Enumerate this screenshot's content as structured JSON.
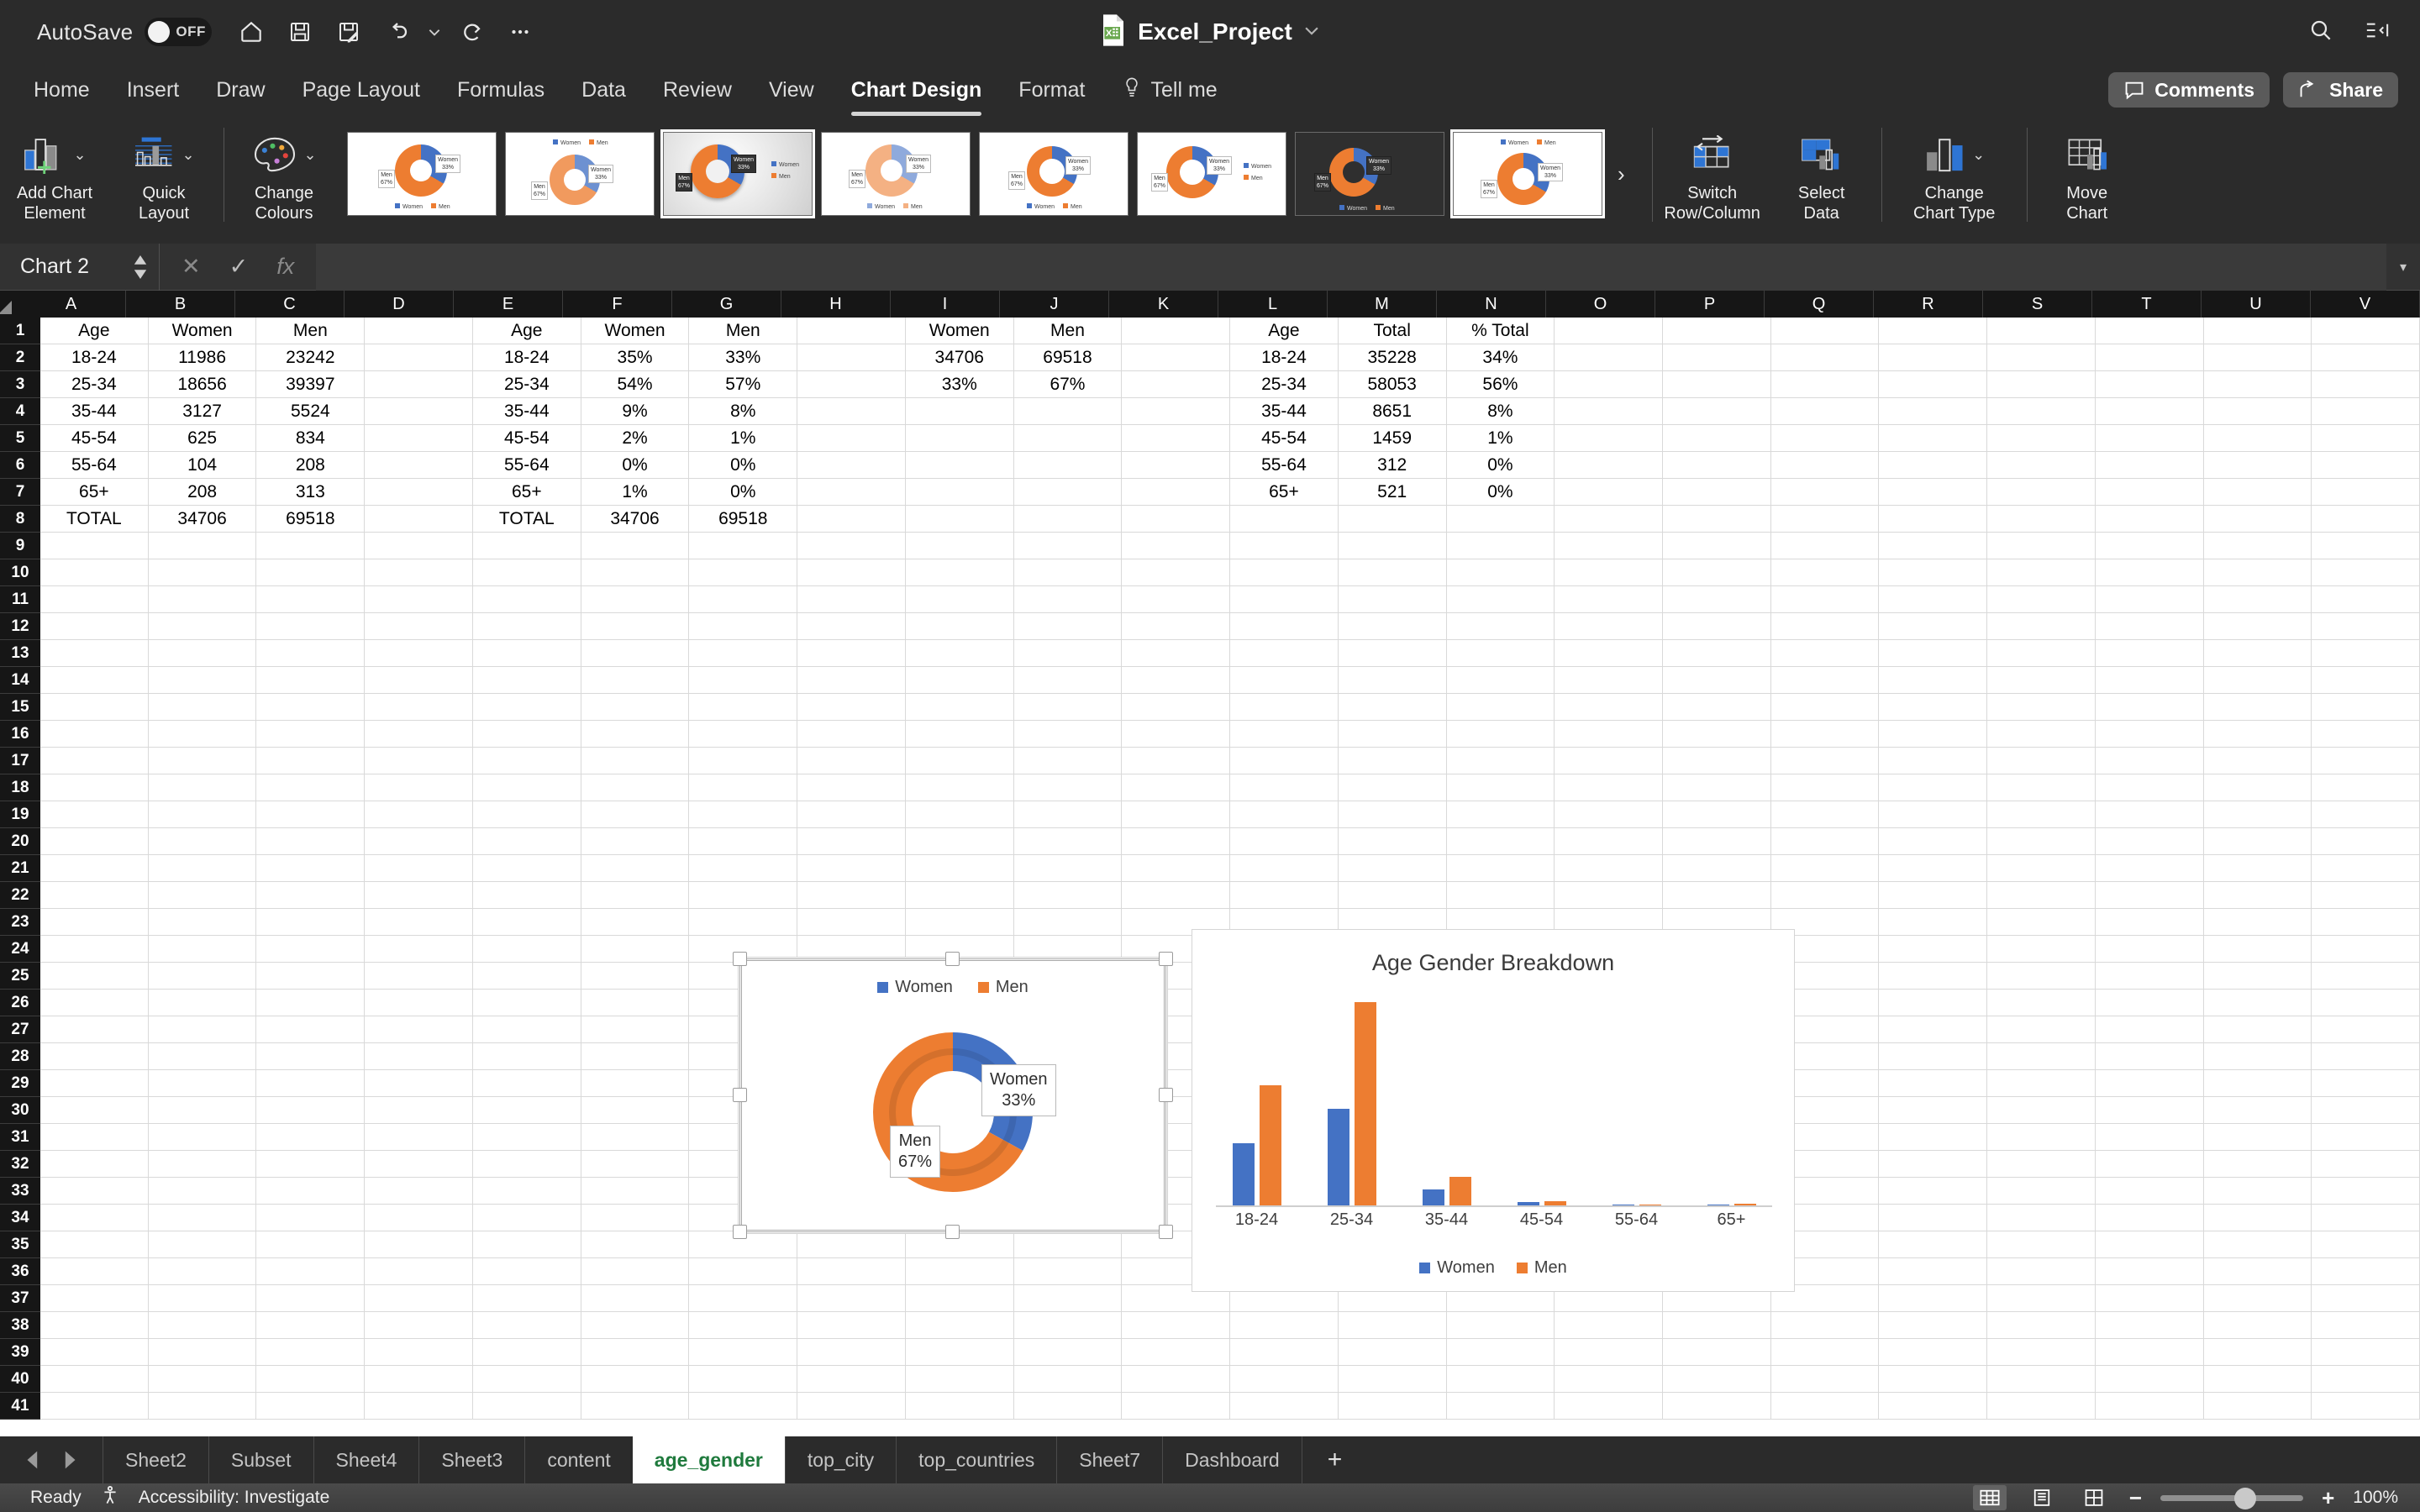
{
  "titlebar": {
    "autosave_label": "AutoSave",
    "autosave_state": "OFF",
    "doc_title": "Excel_Project",
    "icons": [
      "home-icon",
      "save-icon",
      "save-as-icon",
      "undo-icon",
      "undo-dropdown-icon",
      "redo-icon",
      "more-commands-icon",
      "search-icon",
      "ribbon-display-icon"
    ]
  },
  "tabs": {
    "items": [
      {
        "label": "Home",
        "active": false
      },
      {
        "label": "Insert",
        "active": false
      },
      {
        "label": "Draw",
        "active": false
      },
      {
        "label": "Page Layout",
        "active": false
      },
      {
        "label": "Formulas",
        "active": false
      },
      {
        "label": "Data",
        "active": false
      },
      {
        "label": "Review",
        "active": false
      },
      {
        "label": "View",
        "active": false
      },
      {
        "label": "Chart Design",
        "active": true
      },
      {
        "label": "Format",
        "active": false
      },
      {
        "label": "Tell me",
        "active": false
      }
    ],
    "comments_label": "Comments",
    "share_label": "Share"
  },
  "ribbon": {
    "add_chart_element": "Add Chart\nElement",
    "add_chart_element_l1": "Add Chart",
    "add_chart_element_l2": "Element",
    "quick_layout_l1": "Quick",
    "quick_layout_l2": "Layout",
    "change_colours_l1": "Change",
    "change_colours_l2": "Colours",
    "switch_row_column_l1": "Switch",
    "switch_row_column_l2": "Row/Column",
    "select_data_l1": "Select",
    "select_data_l2": "Data",
    "change_chart_type_l1": "Change",
    "change_chart_type_l2": "Chart Type",
    "move_chart_l1": "Move",
    "move_chart_l2": "Chart",
    "gallery_more": "›",
    "gallery_styles": [
      {
        "id": "style-1",
        "selected": false,
        "bg": "white",
        "legend": "bottom"
      },
      {
        "id": "style-2",
        "selected": false,
        "bg": "white",
        "legend": "top"
      },
      {
        "id": "style-3",
        "selected": true,
        "bg": "gradient",
        "legend": "right"
      },
      {
        "id": "style-4",
        "selected": false,
        "bg": "white",
        "legend": "bottom"
      },
      {
        "id": "style-5",
        "selected": false,
        "bg": "white",
        "legend": "bottom"
      },
      {
        "id": "style-6",
        "selected": false,
        "bg": "white",
        "legend": "right"
      },
      {
        "id": "style-7",
        "selected": false,
        "bg": "dark",
        "legend": "bottom"
      },
      {
        "id": "style-8",
        "selected": false,
        "bg": "white",
        "legend": "top"
      }
    ]
  },
  "formulabar": {
    "namebox_value": "Chart 2",
    "cancel_icon": "✕",
    "enter_icon": "✓",
    "fx_icon": "fx",
    "formula_value": ""
  },
  "grid": {
    "columns": [
      "A",
      "B",
      "C",
      "D",
      "E",
      "F",
      "G",
      "H",
      "I",
      "J",
      "K",
      "L",
      "M",
      "N",
      "O",
      "P",
      "Q",
      "R",
      "S",
      "T",
      "U",
      "V"
    ],
    "rows": [
      1,
      2,
      3,
      4,
      5,
      6,
      7,
      8,
      9,
      10,
      11,
      12,
      13,
      14,
      15,
      16,
      17,
      18,
      19,
      20,
      21,
      22,
      23,
      24,
      25,
      26,
      27,
      28,
      29,
      30,
      31,
      32,
      33,
      34,
      35,
      36,
      37,
      38,
      39,
      40,
      41
    ],
    "data": [
      [
        "Age",
        "Women",
        "Men",
        "",
        "Age",
        "Women",
        "Men",
        "",
        "Women",
        "Men",
        "",
        "Age",
        "Total",
        "% Total",
        "",
        "",
        "",
        "",
        "",
        "",
        "",
        ""
      ],
      [
        "18-24",
        "11986",
        "23242",
        "",
        "18-24",
        "35%",
        "33%",
        "",
        "34706",
        "69518",
        "",
        "18-24",
        "35228",
        "34%",
        "",
        "",
        "",
        "",
        "",
        "",
        "",
        ""
      ],
      [
        "25-34",
        "18656",
        "39397",
        "",
        "25-34",
        "54%",
        "57%",
        "",
        "33%",
        "67%",
        "",
        "25-34",
        "58053",
        "56%",
        "",
        "",
        "",
        "",
        "",
        "",
        "",
        ""
      ],
      [
        "35-44",
        "3127",
        "5524",
        "",
        "35-44",
        "9%",
        "8%",
        "",
        "",
        "",
        "",
        "35-44",
        "8651",
        "8%",
        "",
        "",
        "",
        "",
        "",
        "",
        "",
        ""
      ],
      [
        "45-54",
        "625",
        "834",
        "",
        "45-54",
        "2%",
        "1%",
        "",
        "",
        "",
        "",
        "45-54",
        "1459",
        "1%",
        "",
        "",
        "",
        "",
        "",
        "",
        "",
        ""
      ],
      [
        "55-64",
        "104",
        "208",
        "",
        "55-64",
        "0%",
        "0%",
        "",
        "",
        "",
        "",
        "55-64",
        "312",
        "0%",
        "",
        "",
        "",
        "",
        "",
        "",
        "",
        ""
      ],
      [
        "65+",
        "208",
        "313",
        "",
        "65+",
        "1%",
        "0%",
        "",
        "",
        "",
        "",
        "65+",
        "521",
        "0%",
        "",
        "",
        "",
        "",
        "",
        "",
        "",
        ""
      ],
      [
        "TOTAL",
        "34706",
        "69518",
        "",
        "TOTAL",
        "34706",
        "69518",
        "",
        "",
        "",
        "",
        "",
        "",
        "",
        "",
        "",
        "",
        "",
        "",
        "",
        "",
        ""
      ]
    ]
  },
  "donut_chart": {
    "name": "Chart 2",
    "selected": true,
    "legend": [
      {
        "label": "Women",
        "color": "#4472c4"
      },
      {
        "label": "Men",
        "color": "#ed7d31"
      }
    ],
    "callouts": [
      {
        "name": "Women",
        "value": "33%"
      },
      {
        "name": "Men",
        "value": "67%"
      }
    ]
  },
  "bar_chart": {
    "title": "Age Gender Breakdown",
    "legend": [
      {
        "label": "Women",
        "color": "#4472c4"
      },
      {
        "label": "Men",
        "color": "#ed7d31"
      }
    ]
  },
  "chart_data": [
    {
      "type": "pie",
      "title": "",
      "subtype": "doughnut",
      "labels": [
        "Women",
        "Men"
      ],
      "values": [
        34706,
        69518
      ],
      "percentages": [
        33,
        67
      ],
      "colors": [
        "#4472c4",
        "#ed7d31"
      ],
      "legend_position": "top",
      "data_labels": [
        "Women 33%",
        "Men 67%"
      ]
    },
    {
      "type": "bar",
      "title": "Age Gender Breakdown",
      "categories": [
        "18-24",
        "25-34",
        "35-44",
        "45-54",
        "55-64",
        "65+"
      ],
      "series": [
        {
          "name": "Women",
          "color": "#4472c4",
          "values": [
            11986,
            18656,
            3127,
            625,
            104,
            208
          ]
        },
        {
          "name": "Men",
          "color": "#ed7d31",
          "values": [
            23242,
            39397,
            5524,
            834,
            208,
            313
          ]
        }
      ],
      "xlabel": "",
      "ylabel": "",
      "ylim": [
        0,
        39397
      ],
      "grid": false,
      "legend_position": "bottom"
    }
  ],
  "sheets": {
    "items": [
      {
        "label": "Sheet2",
        "active": false
      },
      {
        "label": "Subset",
        "active": false
      },
      {
        "label": "Sheet4",
        "active": false
      },
      {
        "label": "Sheet3",
        "active": false
      },
      {
        "label": "content",
        "active": false
      },
      {
        "label": "age_gender",
        "active": true
      },
      {
        "label": "top_city",
        "active": false
      },
      {
        "label": "top_countries",
        "active": false
      },
      {
        "label": "Sheet7",
        "active": false
      },
      {
        "label": "Dashboard",
        "active": false
      }
    ],
    "add_label": "+"
  },
  "statusbar": {
    "ready": "Ready",
    "accessibility": "Accessibility: Investigate",
    "zoom": "100%",
    "zoom_out": "−",
    "zoom_in": "+"
  }
}
